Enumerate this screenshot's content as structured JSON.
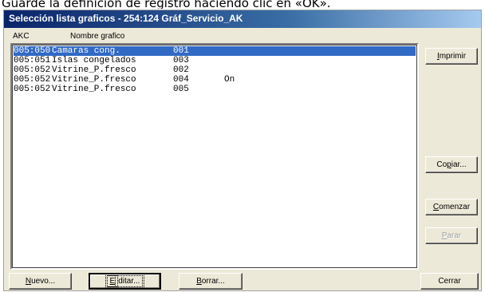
{
  "caption": "Guarde la definición de registro haciendo clic en «OK».",
  "window": {
    "title": "Selección lista graficos - 254:124  Gráf_Servicio_AK"
  },
  "list": {
    "columns": [
      "AKC",
      "Nombre grafico"
    ],
    "rows": [
      {
        "akc": "005:050",
        "name": "Camaras cong.",
        "num": "001",
        "status": "",
        "selected": true
      },
      {
        "akc": "005:051",
        "name": "Islas congelados",
        "num": "003",
        "status": "",
        "selected": false
      },
      {
        "akc": "005:052",
        "name": "Vitrine_P.fresco",
        "num": "002",
        "status": "",
        "selected": false
      },
      {
        "akc": "005:052",
        "name": "Vitrine_P.fresco",
        "num": "004",
        "status": "On",
        "selected": false
      },
      {
        "akc": "005:052",
        "name": "Vitrine_P.fresco",
        "num": "005",
        "status": "",
        "selected": false
      }
    ]
  },
  "buttons": {
    "imprimir": {
      "first": "I",
      "rest": "mprimir"
    },
    "copiar": {
      "first": "Co",
      "u": "p",
      "rest": "iar..."
    },
    "comenzar": {
      "first": "",
      "u": "C",
      "rest": "omenzar"
    },
    "parar": {
      "first": "",
      "u": "P",
      "rest": "arar"
    },
    "nuevo": {
      "u": "N",
      "rest": "uevo..."
    },
    "editar": {
      "u": "E",
      "rest": "ditar..."
    },
    "borrar": {
      "u": "B",
      "rest": "orrar..."
    },
    "cerrar": "Cerrar"
  }
}
